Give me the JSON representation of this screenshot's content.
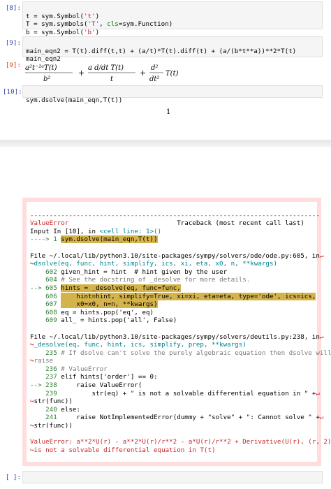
{
  "cells": [
    {
      "prompt": "[8]:",
      "lines": [
        "t = sym.Symbol('t')",
        "T = sym.symbols('T', cls=sym.Function)",
        "b = sym.Symbol('b')"
      ]
    },
    {
      "prompt": "[9]:",
      "lines": [
        "main_eqn2 = T(t).diff(t,t) + (a/t)*T(t).diff(t) + (a/(b*t**a))**2*T(t)",
        "main_eqn2"
      ]
    },
    {
      "prompt": "[10]:",
      "lines": [
        "sym.dsolve(main_eqn,T(t))"
      ]
    },
    {
      "prompt": "[ ]:",
      "lines": [
        ""
      ]
    }
  ],
  "output9": {
    "prompt": "[9]:",
    "term1_num": "a²t⁻²ᵃT(t)",
    "term1_den": "b²",
    "term2_num": "a d/dt T(t)",
    "term2_den": "t",
    "term3_num": "d²",
    "term3_den": "dt²",
    "term3_tail": "T(t)",
    "plus": "+"
  },
  "page_number": "1",
  "error": {
    "dashes": "---------------------------------------------------------------------------",
    "name": "ValueError",
    "traceback_label": "Traceback (most recent call last)",
    "input_line": "Input In [10], in ",
    "cell_line": "<cell line: 1>()",
    "frame0_arrow": "----> 1 ",
    "frame0_code": "sym.dsolve(main_eqn,T(t))",
    "file1": "File ~/.local/lib/python3.10/site-packages/sympy/solvers/ode/ode.py:605, in",
    "file1_cont": "dsolve(eq, func, hint, simplify, ics, xi, eta, x0, n, **kwargs)",
    "frame1": [
      {
        "n": "602",
        "code": "given_hint = hint  # hint given by the user"
      },
      {
        "n": "604",
        "code": "# See the docstring of _desolve for more details."
      },
      {
        "n": "605",
        "code": "hints = _desolve(eq, func=func,",
        "arrow": "--> "
      },
      {
        "n": "606",
        "code": "    hint=hint, simplify=True, xi=xi, eta=eta, type='ode', ics=ics,"
      },
      {
        "n": "607",
        "code": "    x0=x0, n=n, **kwargs)"
      },
      {
        "n": "608",
        "code": "eq = hints.pop('eq', eq)"
      },
      {
        "n": "609",
        "code": "all_ = hints.pop('all', False)"
      }
    ],
    "file2": "File ~/.local/lib/python3.10/site-packages/sympy/solvers/deutils.py:238, in",
    "file2_cont": "_desolve(eq, func, hint, ics, simplify, prep, **kwargs)",
    "frame2": [
      {
        "n": "235",
        "code": "# If dsolve can't solve the purely algebraic equation then dsolve will"
      },
      {
        "n": "",
        "code": "raise",
        "cont": true
      },
      {
        "n": "236",
        "code": "# ValueError"
      },
      {
        "n": "237",
        "code": "elif hints['order'] == 0:"
      },
      {
        "n": "238",
        "code": "    raise ValueError(",
        "arrow": "--> "
      },
      {
        "n": "239",
        "code": "        str(eq) + \" is not a solvable differential equation in \" +"
      },
      {
        "n": "",
        "code": "str(func))",
        "cont": true
      },
      {
        "n": "240",
        "code": "else:"
      },
      {
        "n": "241",
        "code": "    raise NotImplementedError(dummy + \"solve\" + \": Cannot solve \" +"
      },
      {
        "n": "",
        "code": "str(func))",
        "cont": true
      }
    ],
    "final1": "ValueError: a**2*U(r) - a**2*U(r)/r**2 - a*U(r)/r**2 + Derivative(U(r), (r, 2)),",
    "final2": "is not a solvable differential equation in T(t)"
  }
}
